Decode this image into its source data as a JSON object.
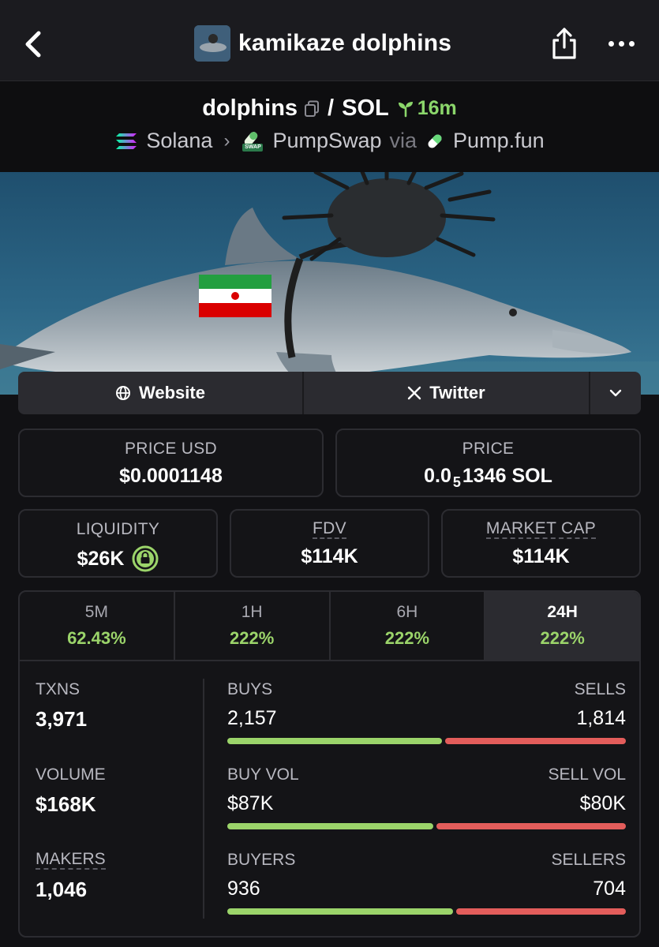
{
  "header": {
    "title": "kamikaze dolphins"
  },
  "pair": {
    "base": "dolphins",
    "separator": "/",
    "quote": "SOL",
    "age": "16m",
    "chain": "Solana",
    "dex": "PumpSwap",
    "via_label": "via",
    "launchpad": "Pump.fun",
    "dex_badge_text": "SWAP"
  },
  "links": {
    "website": "Website",
    "twitter": "Twitter"
  },
  "stats_cards": {
    "price_usd_label": "PRICE USD",
    "price_usd_value": "$0.0001148",
    "price_label": "PRICE",
    "price_prefix": "0.0",
    "price_subscript": "5",
    "price_suffix": "1346 SOL",
    "liquidity_label": "LIQUIDITY",
    "liquidity_value": "$26K",
    "fdv_label": "FDV",
    "fdv_value": "$114K",
    "mcap_label": "MARKET CAP",
    "mcap_value": "$114K"
  },
  "timeframes": [
    {
      "label": "5M",
      "value": "62.43%"
    },
    {
      "label": "1H",
      "value": "222%"
    },
    {
      "label": "6H",
      "value": "222%"
    },
    {
      "label": "24H",
      "value": "222%"
    }
  ],
  "activity": {
    "txns_label": "TXNS",
    "txns_value": "3,971",
    "volume_label": "VOLUME",
    "volume_value": "$168K",
    "makers_label": "MAKERS",
    "makers_value": "1,046",
    "buys_label": "BUYS",
    "buys_value": "2,157",
    "sells_label": "SELLS",
    "sells_value": "1,814",
    "buyvol_label": "BUY VOL",
    "buyvol_value": "$87K",
    "sellvol_label": "SELL VOL",
    "sellvol_value": "$80K",
    "buyers_label": "BUYERS",
    "buyers_value": "936",
    "sellers_label": "SELLERS",
    "sellers_value": "704",
    "buy_share_txns": 0.543,
    "buy_share_vol": 0.521,
    "buy_share_makers": 0.571
  },
  "colors": {
    "positive": "#9bd46a",
    "negative": "#e35d5b",
    "age": "#8bd66b"
  }
}
